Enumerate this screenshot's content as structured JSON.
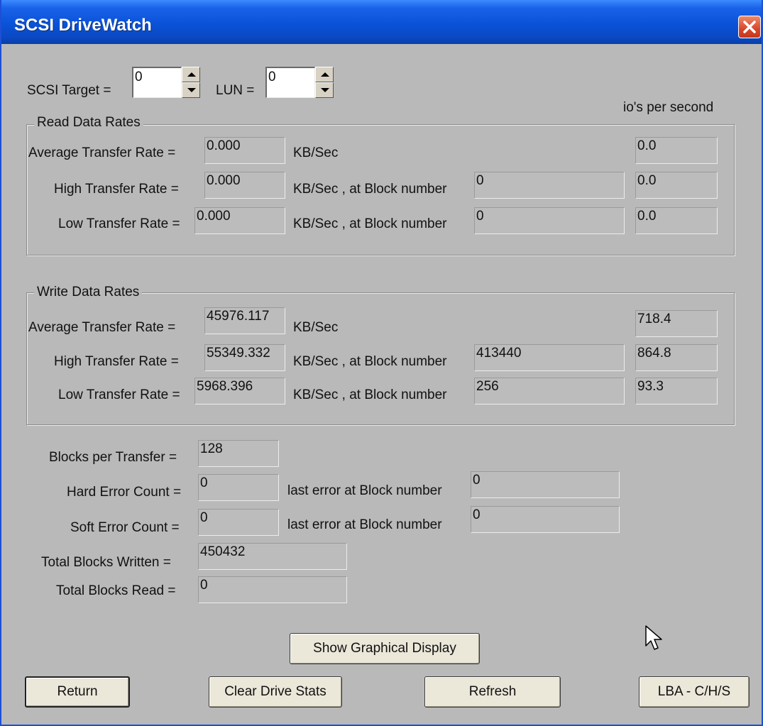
{
  "window": {
    "title": "SCSI DriveWatch"
  },
  "selector": {
    "target_label": "SCSI Target =",
    "target_value": "0",
    "lun_label": "LUN =",
    "lun_value": "0"
  },
  "ios_header": "io's per second",
  "read": {
    "legend": "Read Data Rates",
    "avg_label": "Average Transfer Rate =",
    "avg_value": "0.000",
    "avg_unit": "KB/Sec",
    "avg_ios": "0.0",
    "high_label": "High Transfer Rate =",
    "high_value": "0.000",
    "high_unit": "KB/Sec , at Block number",
    "high_block": "0",
    "high_ios": "0.0",
    "low_label": "Low Transfer Rate =",
    "low_value": "0.000",
    "low_unit": "KB/Sec , at Block number",
    "low_block": "0",
    "low_ios": "0.0"
  },
  "write": {
    "legend": "Write Data Rates",
    "avg_label": "Average Transfer Rate =",
    "avg_value": "45976.117",
    "avg_unit": "KB/Sec",
    "avg_ios": "718.4",
    "high_label": "High Transfer Rate =",
    "high_value": "55349.332",
    "high_unit": "KB/Sec , at Block number",
    "high_block": "413440",
    "high_ios": "864.8",
    "low_label": "Low Transfer Rate =",
    "low_value": "5968.396",
    "low_unit": "KB/Sec , at Block number",
    "low_block": "256",
    "low_ios": "93.3"
  },
  "stats": {
    "blocks_per_transfer_label": "Blocks per Transfer =",
    "blocks_per_transfer": "128",
    "hard_error_label": "Hard Error Count =",
    "hard_error_count": "0",
    "hard_last_label": "last error at Block number",
    "hard_last_block": "0",
    "soft_error_label": "Soft Error Count =",
    "soft_error_count": "0",
    "soft_last_label": "last error at Block number",
    "soft_last_block": "0",
    "total_written_label": "Total Blocks Written =",
    "total_written": "450432",
    "total_read_label": "Total Blocks Read =",
    "total_read": "0"
  },
  "buttons": {
    "graphical": "Show Graphical Display",
    "return": "Return",
    "clear": "Clear Drive Stats",
    "refresh": "Refresh",
    "lba": "LBA - C/H/S"
  },
  "icons": {
    "close": "close-icon",
    "spin_up": "spin-up-arrow-icon",
    "spin_down": "spin-down-arrow-icon",
    "cursor": "mouse-pointer-icon"
  },
  "colors": {
    "titlebar": "#0a52d8",
    "window_bg": "#b9b9b9",
    "close_button": "#d8462a",
    "button_face": "#ebe7d9"
  }
}
